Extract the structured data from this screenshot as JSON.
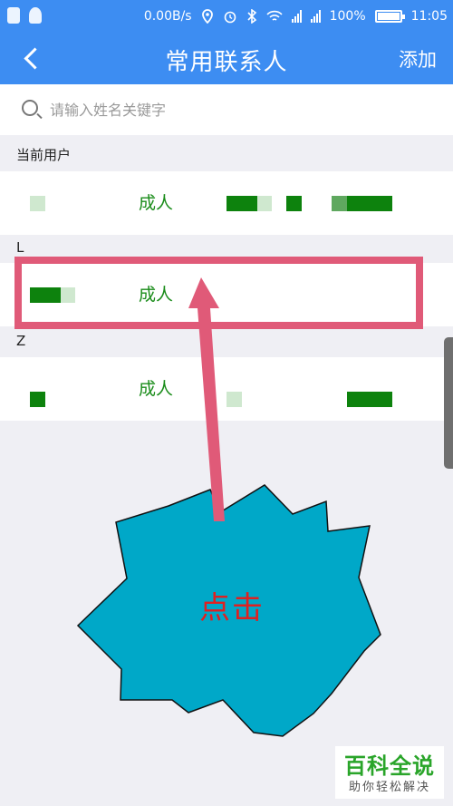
{
  "status_bar": {
    "speed": "0.00B/s",
    "battery": "100%",
    "time": "11:05"
  },
  "navbar": {
    "title": "常用联系人",
    "add_label": "添加"
  },
  "search": {
    "placeholder": "请输入姓名关键字"
  },
  "sections": [
    {
      "header": "当前用户",
      "contacts": [
        {
          "type": "成人"
        }
      ]
    },
    {
      "header": "L",
      "contacts": [
        {
          "type": "成人"
        }
      ]
    },
    {
      "header": "Z",
      "contacts": [
        {
          "type": "成人"
        }
      ]
    }
  ],
  "annotation": {
    "callout_text": "点击",
    "highlight_color": "#e05a78",
    "burst_color": "#00a8c8"
  },
  "watermark": {
    "title": "百科全说",
    "subtitle": "助你轻松解决"
  },
  "colors": {
    "accent": "#3d8df2",
    "contact_type": "#1a8c1a"
  },
  "icons": [
    "back-arrow-icon",
    "search-icon",
    "qq-icon",
    "shield-icon",
    "location-icon",
    "alarm-icon",
    "bluetooth-icon",
    "wifi-icon",
    "signal-icon",
    "battery-icon"
  ]
}
